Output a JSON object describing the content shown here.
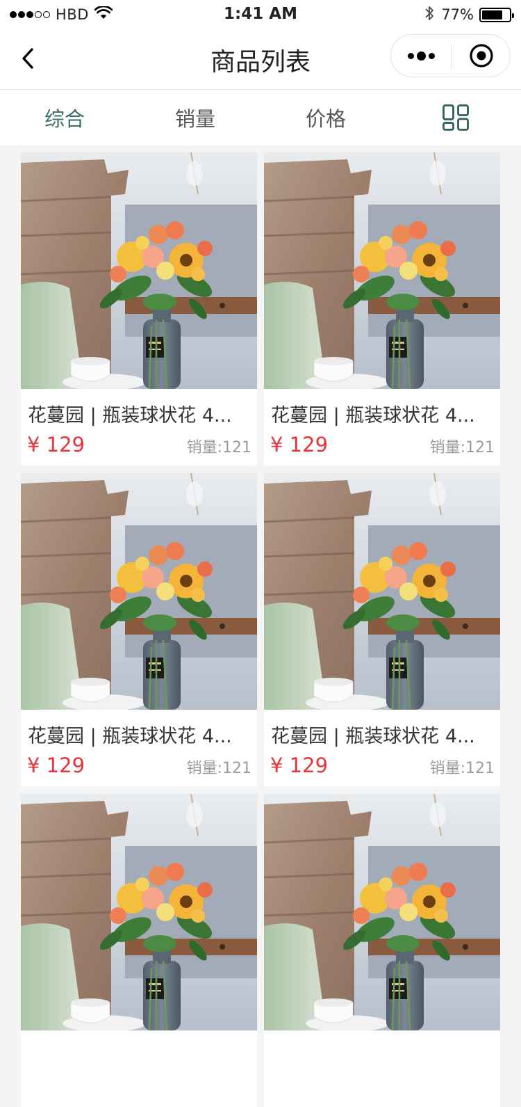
{
  "status_bar": {
    "carrier": "HBD",
    "signal_bars_on": 3,
    "signal_bars_total": 5,
    "time": "1:41 AM",
    "battery_percent": "77%",
    "battery_level": 0.77,
    "icons": [
      "wifi-icon",
      "bluetooth-icon",
      "battery-icon"
    ]
  },
  "nav": {
    "title": "商品列表",
    "icons": [
      "back-chevron-icon",
      "more-dots-icon",
      "close-target-icon"
    ]
  },
  "filter_tabs": {
    "items": [
      {
        "label": "综合",
        "active": true
      },
      {
        "label": "销量",
        "active": false
      },
      {
        "label": "价格",
        "active": false
      }
    ],
    "layout_toggle_icon": "grid-layout-icon"
  },
  "products": [
    {
      "title": "花蔓园 | 瓶装球状花 4...",
      "price": "¥ 129",
      "sales": "销量:121",
      "image": "flower-vase-photo"
    },
    {
      "title": "花蔓园 | 瓶装球状花 4...",
      "price": "¥ 129",
      "sales": "销量:121",
      "image": "flower-vase-photo"
    },
    {
      "title": "花蔓园 | 瓶装球状花 4...",
      "price": "¥ 129",
      "sales": "销量:121",
      "image": "flower-vase-photo"
    },
    {
      "title": "花蔓园 | 瓶装球状花 4...",
      "price": "¥ 129",
      "sales": "销量:121",
      "image": "flower-vase-photo"
    },
    {
      "title": "",
      "price": "",
      "sales": "",
      "image": "flower-vase-photo"
    },
    {
      "title": "",
      "price": "",
      "sales": "",
      "image": "flower-vase-photo"
    }
  ],
  "colors": {
    "accent": "#3a6f66",
    "price": "#e8353b",
    "muted": "#9a9a9a",
    "background": "#f4f4f4"
  }
}
